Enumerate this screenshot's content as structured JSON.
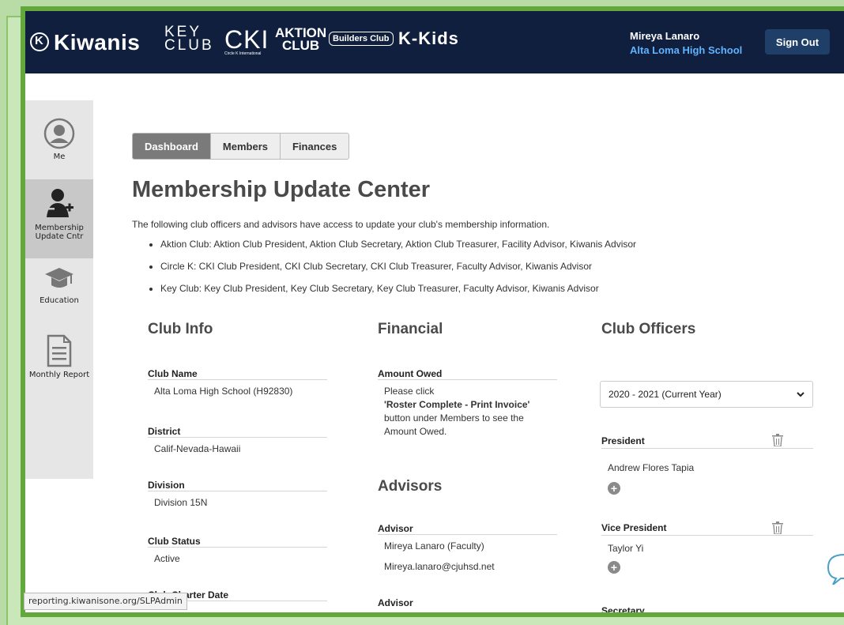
{
  "header": {
    "brands": {
      "kiwanis": "Kiwanis",
      "key_club": "KEY CLUB",
      "cki": "CKI",
      "cki_sub": "Circle K International",
      "aktion": "AKTION CLUB",
      "builders": "Builders Club",
      "kkids": "K-Kids"
    },
    "user_name": "Mireya Lanaro",
    "user_school": "Alta Loma High School",
    "sign_out": "Sign Out"
  },
  "sidebar": {
    "items": [
      {
        "label": "Me",
        "icon": "user-circle-icon"
      },
      {
        "label": "Membership Update Cntr",
        "icon": "add-user-icon"
      },
      {
        "label": "Education",
        "icon": "graduation-cap-icon"
      },
      {
        "label": "Monthly Report",
        "icon": "document-icon"
      }
    ]
  },
  "tabs": [
    "Dashboard",
    "Members",
    "Finances"
  ],
  "page_title": "Membership Update Center",
  "intro": "The following club officers and advisors have access to update your club's membership information.",
  "bullets": [
    "Aktion Club: Aktion Club President, Aktion Club Secretary, Aktion Club Treasurer, Facility Advisor, Kiwanis Advisor",
    "Circle K: CKI Club President, CKI Club Secretary, CKI Club Treasurer, Faculty Advisor, Kiwanis Advisor",
    "Key Club: Key Club President, Key Club Secretary, Key Club Treasurer, Faculty Advisor, Kiwanis Advisor"
  ],
  "club_info": {
    "heading": "Club Info",
    "club_name_label": "Club Name",
    "club_name": "Alta Loma High School (H92830)",
    "district_label": "District",
    "district": "Calif-Nevada-Hawaii",
    "division_label": "Division",
    "division": "Division 15N",
    "status_label": "Club Status",
    "status": "Active",
    "charter_label": "Club Charter Date"
  },
  "financial": {
    "heading": "Financial",
    "amount_label": "Amount Owed",
    "line1": "Please click",
    "line2": "'Roster Complete - Print Invoice'",
    "line3": "button under Members to see the",
    "line4": "Amount Owed."
  },
  "advisors": {
    "heading": "Advisors",
    "advisor_label": "Advisor",
    "advisor1_name": "Mireya Lanaro (Faculty)",
    "advisor1_email": "Mireya.lanaro@cjuhsd.net",
    "advisor2_label": "Advisor"
  },
  "officers": {
    "heading": "Club Officers",
    "year_selected": "2020 - 2021 (Current Year)",
    "president_label": "President",
    "president": "Andrew Flores Tapia",
    "vp_label": "Vice President",
    "vp": "Taylor Yi",
    "secretary_label": "Secretary"
  },
  "status_bar_url": "reporting.kiwanisone.org/SLPAdmin"
}
